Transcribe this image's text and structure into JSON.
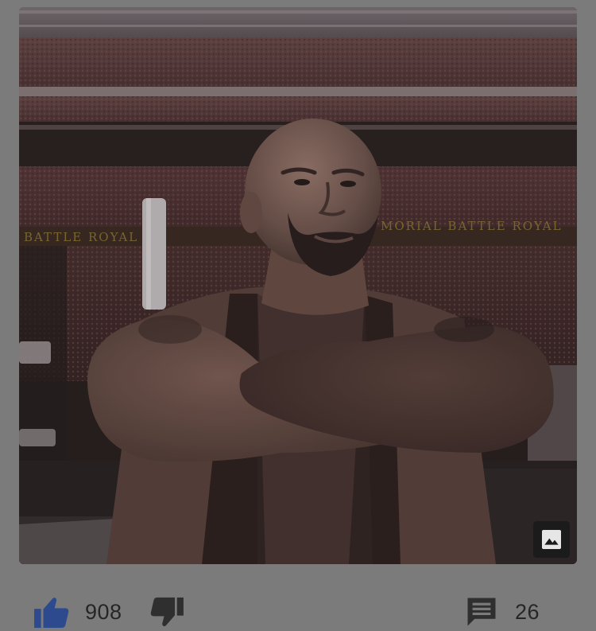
{
  "media": {
    "icon": "image-icon",
    "banner_text": "BATTLE ROYAL"
  },
  "actions": {
    "like": {
      "icon": "thumbs-up-icon",
      "count": "908",
      "color": "#2d4a8f"
    },
    "dislike": {
      "icon": "thumbs-down-icon",
      "color": "#2f2f2f"
    },
    "comments": {
      "icon": "comment-icon",
      "count": "26",
      "color": "#2f2f2f"
    }
  },
  "colors": {
    "background": "#7b7b7b",
    "text": "#262626"
  }
}
